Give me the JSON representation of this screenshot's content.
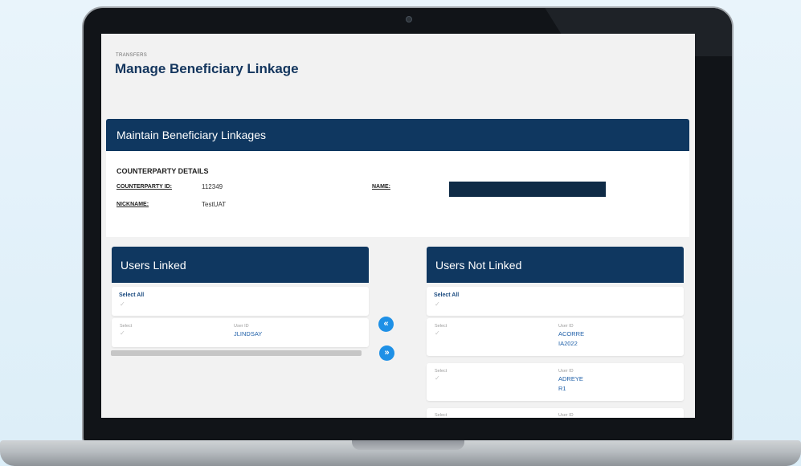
{
  "breadcrumb": "TRANSFERS",
  "page_title": "Manage Beneficiary Linkage",
  "maintain_header": "Maintain Beneficiary Linkages",
  "counterparty": {
    "section_title": "COUNTERPARTY DETAILS",
    "id_label": "COUNTERPARTY ID:",
    "id_value": "112349",
    "name_label": "NAME:",
    "nickname_label": "NICKNAME:",
    "nickname_value": "TestUAT"
  },
  "linked": {
    "title": "Users Linked",
    "select_all": "Select All",
    "rows": [
      {
        "select_label": "Select",
        "userid_label": "User ID",
        "userid": "JLINDSAY"
      }
    ]
  },
  "not_linked": {
    "title": "Users Not Linked",
    "select_all": "Select All",
    "rows": [
      {
        "select_label": "Select",
        "userid_label": "User ID",
        "userid_line1": "ACORRE",
        "userid_line2": "IA2022"
      },
      {
        "select_label": "Select",
        "userid_label": "User ID",
        "userid_line1": "ADREYE",
        "userid_line2": "R1"
      },
      {
        "select_label": "Select",
        "userid_label": "User ID"
      }
    ]
  },
  "buttons": {
    "move_left": "«",
    "move_right": "»"
  },
  "icons": {
    "check": "✓"
  },
  "colors": {
    "header_bg": "#0f3760",
    "accent_button": "#1e90e6",
    "link_text": "#1e5fa8"
  }
}
